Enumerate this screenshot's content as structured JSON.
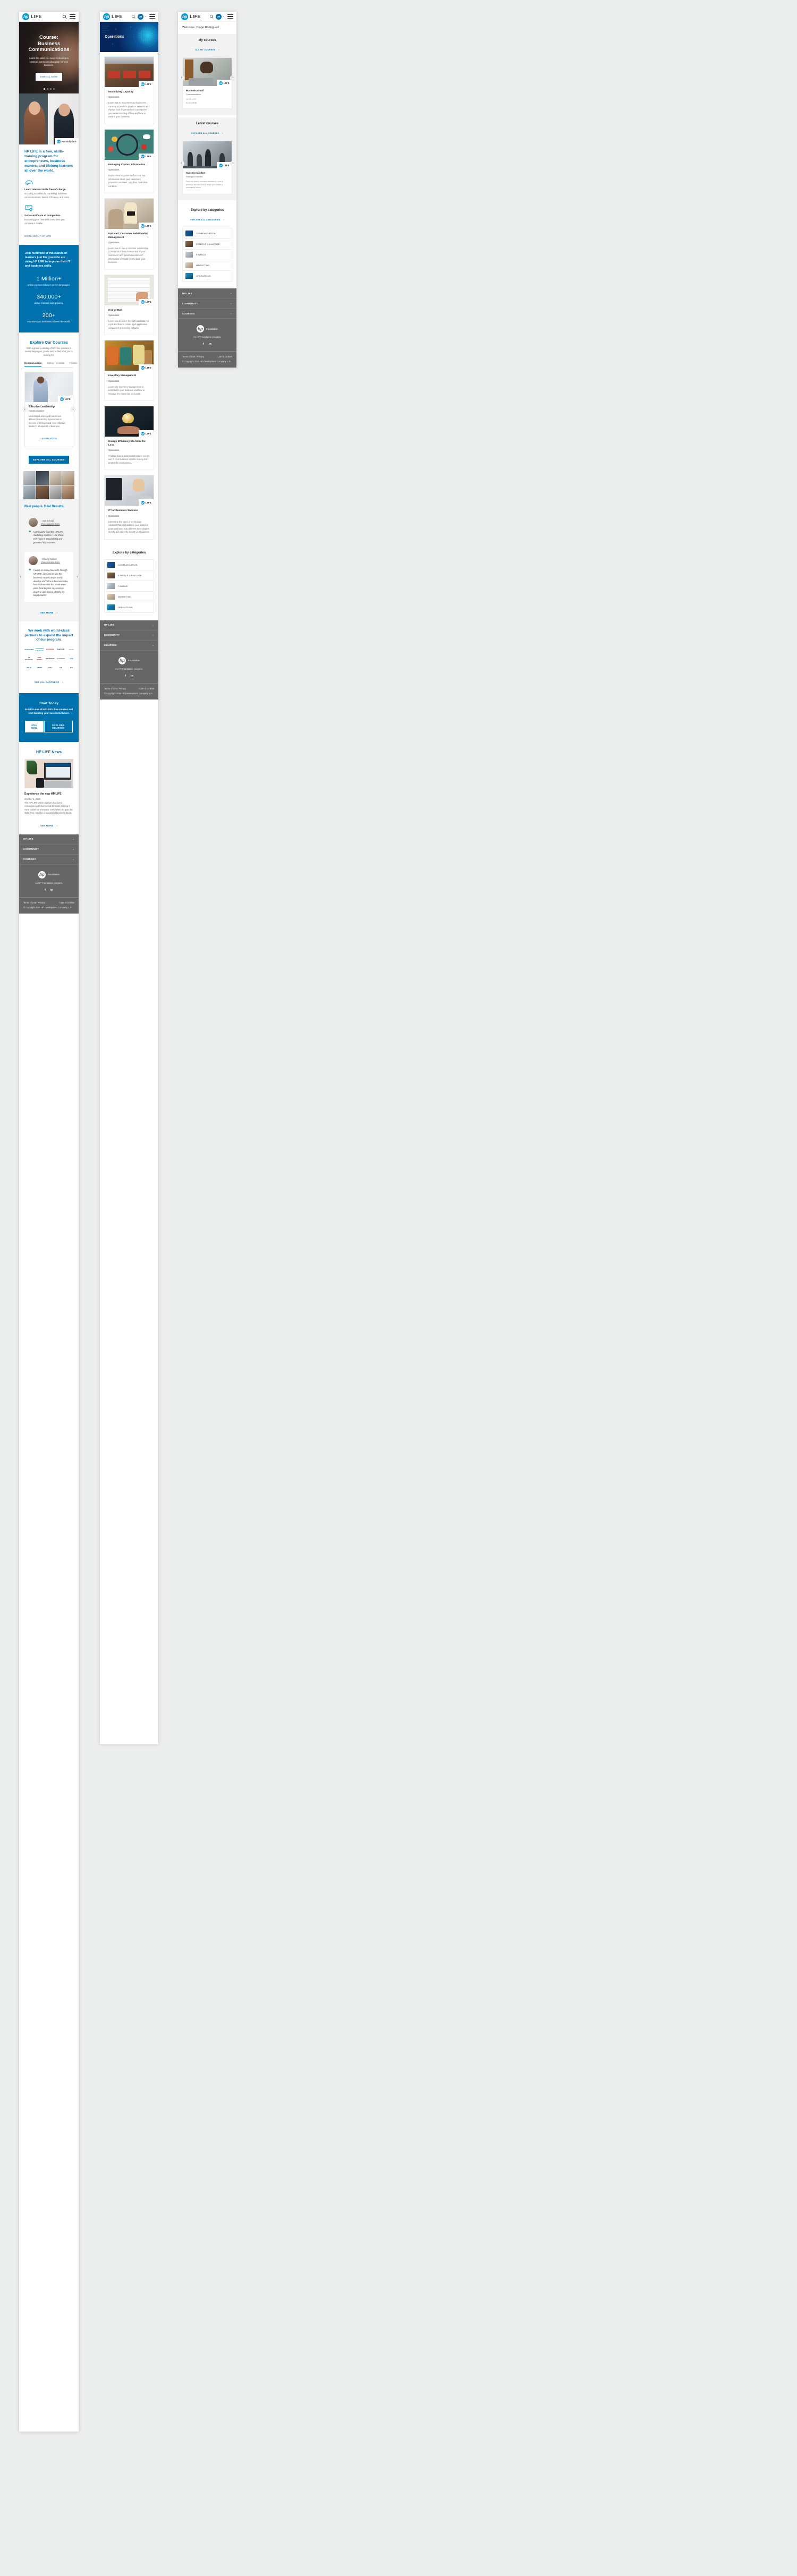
{
  "brand": {
    "logo": "hp-logo",
    "name": "LIFE"
  },
  "col1": {
    "hero": {
      "title": "Course: Business Communications",
      "subtitle": "Learn the skills you need to develop a strategic communication plan for your business.",
      "cta": "ENROLL NOW",
      "dots": 4,
      "active_dot": 0
    },
    "intro": {
      "heading": "HP LIFE is a free, skills-training program for entrepreneurs, business owners, and lifelong learners all over the world.",
      "features": [
        {
          "icon": "gauge-icon",
          "title": "Learn relevant skills free of charge.",
          "text": "Including social media marketing, business communications, basics of finance, and more."
        },
        {
          "icon": "certificate-icon",
          "title": "Get a certificate of completion.",
          "text": "Endorsing your new skills every time you complete a course."
        }
      ],
      "more_link": "MORE ABOUT HP LIFE"
    },
    "stats": {
      "lead": "Join hundreds of thousands of learners just like you who are using HP LIFE to improve their IT and business skills.",
      "items": [
        {
          "number": "1 Million+",
          "caption": "online courses taken in seven languages."
        },
        {
          "number": "340,000+",
          "caption": "active learners and growing."
        },
        {
          "number": "200+",
          "caption": "countries and territories all over the world."
        }
      ]
    },
    "explore": {
      "title": "Explore Our Courses",
      "subtitle": "With a growing catalog of 32+ free courses in seven languages, you're sure to find what you're looking for.",
      "tabs": [
        "Communication",
        "Startup / Innovate",
        "Finance",
        "M"
      ],
      "active_tab": 0,
      "course": {
        "title": "Effective Leadership",
        "category": "Communication",
        "text": "Understand when and how to use different leadership approaches to become a stronger and more effective leader in all aspects of business.",
        "link": "LEARN MORE"
      },
      "all_button": "EXPLORE ALL COURSES"
    },
    "testimonials": {
      "title": "Real people. Real Results.",
      "items": [
        {
          "name": "- Jael Echajú",
          "link": "View success story",
          "quote": "I particularly liked the HP LIFE marketing courses. I use these every day in the planning and growth of my business."
        },
        {
          "name": "- Charity Selorm",
          "link": "View success story",
          "quote": "I learnt so many new skills through HP LIFE. Like how to use the business model canvas tool to develop and refine a business idea, how to determine the break-even point, how to price my services properly, and how to identify my target market."
        }
      ],
      "see_more": "SEE MORE"
    },
    "partners": {
      "heading": "We work with world-class partners to expand the impact of our program.",
      "logos": [
        "UN WOMEN",
        "LEARNING EQUALITY",
        "access",
        "NACCE",
        "PLAN",
        "JA Worldwide",
        "GIRL RISING",
        "MIT SOLVE",
        "worldskills",
        "SAP",
        "PNUD",
        "UNIDO",
        "BYU",
        "ILO",
        "ITU"
      ],
      "see_all": "SEE ALL PARTNERS"
    },
    "start_today": {
      "title": "Start Today",
      "subtitle": "Enroll in one of HP LIFE's free courses and start building your successful future.",
      "primary": "JOIN NOW",
      "secondary": "EXPLORE COURSES"
    },
    "news": {
      "title": "HP LIFE News",
      "item": {
        "headline": "Experience the new HP LIFE",
        "date": "October 5, 2020",
        "text": "The HP LIFE online platform has been reimagined with learners at its heart, making it even easier for everyone, everywhere to gain the skills they need for a successful business future.",
        "link": "SEE MORE"
      }
    }
  },
  "col2": {
    "banner_title": "Operations",
    "courses": [
      {
        "title": "Maximizing Capacity",
        "category": "Operations",
        "text": "Learn how to maximize your business's capacity to produce goods or services and explore how a spreadsheet can improve your understanding of how staff time is used in your business.",
        "image": "workshop-desks"
      },
      {
        "title": "Managing Contact Information",
        "category": "Operations",
        "text": "Explore how to gather and access key information about your customers, potential customers, suppliers, and other contacts.",
        "image": "magnifier-contacts"
      },
      {
        "title": "Updated: Customer Relationship Management",
        "category": "Operations",
        "text": "Learn how to use a customer relationship (CRM) tool to keep better track of your customers' and potential customers' information to enable you to build your business.",
        "image": "retail-tablet"
      },
      {
        "title": "Hiring Staff",
        "category": "Operations",
        "text": "Learn how to select the right candidate for a job and how to create a job application using word processing software.",
        "image": "resume-review"
      },
      {
        "title": "Inventory Management",
        "category": "Operations",
        "text": "Learn why inventory management is essential to your business and how to manage it to maximize your profit.",
        "image": "grain-sacks"
      },
      {
        "title": "Energy Efficiency: Do More for Less",
        "category": "Operations",
        "text": "Find out how to assess and reduce energy use in your business to save money and protect the environment.",
        "image": "lightbulb-hands"
      },
      {
        "title": "IT for Business Success",
        "category": "Operations",
        "text": "Determine the types of technology solutions that best address your business goals and learn how different technologies directly aid indirectly impact your business.",
        "image": "woman-laptop"
      }
    ],
    "explore": {
      "title": "Explore by categories",
      "categories": [
        "COMMUNICATION",
        "STARTUP / INNOVATE",
        "FINANCE",
        "MARKETING",
        "OPERATIONS"
      ]
    }
  },
  "col3": {
    "welcome": "Welcome, Diogo Rodrigues!",
    "my_courses": {
      "title": "My courses",
      "link": "ALL MY COURSES",
      "card": {
        "title": "Business Email",
        "category": "Communication",
        "meta": "15 HP LIFE",
        "meta2": "IN COURSE",
        "image": "student-laptop"
      }
    },
    "latest": {
      "title": "Latest courses",
      "link": "EXPLORE ALL COURSES",
      "card": {
        "title": "Success Mindset",
        "category": "Startup / Innovate",
        "text": "Find out what a success mindset is, how to develop one and how it helps you create a successful future.",
        "image": "chess-pieces"
      }
    },
    "explore": {
      "title": "Explore by categories",
      "link": "EXPLORE ALL CATEGORIES",
      "categories": [
        "COMMUNICATION",
        "STARTUP / INNOVATE",
        "FINANCE",
        "MARKETING",
        "OPERATIONS"
      ]
    }
  },
  "footer": {
    "accordion": [
      "HP LIFE",
      "COMMUNITY",
      "COURSES"
    ],
    "caret": "⌄",
    "foundation": "Foundation",
    "tagline": "An HP Foundation program.",
    "social": [
      "facebook-icon",
      "linkedin-icon"
    ],
    "links_left": "Terms of Use  /  Privacy",
    "links_right": "/  Use of cookies",
    "copyright": "© Copyright 2020 HP Development Company, L.P."
  }
}
